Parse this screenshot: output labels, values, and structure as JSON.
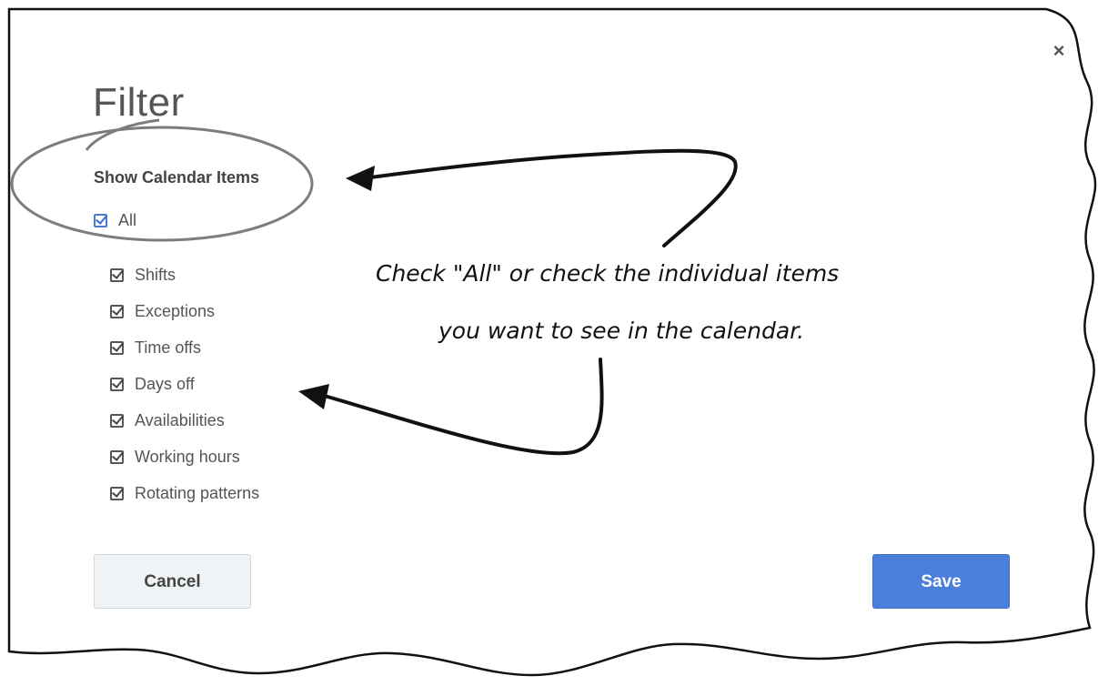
{
  "dialog": {
    "close_glyph": "×",
    "title": "Filter",
    "section_heading": "Show Calendar Items",
    "all_item": {
      "label": "All",
      "checked": true
    },
    "items": [
      {
        "label": "Shifts",
        "checked": true
      },
      {
        "label": "Exceptions",
        "checked": true
      },
      {
        "label": "Time offs",
        "checked": true
      },
      {
        "label": "Days off",
        "checked": true
      },
      {
        "label": "Availabilities",
        "checked": true
      },
      {
        "label": "Working hours",
        "checked": true
      },
      {
        "label": "Rotating patterns",
        "checked": true
      }
    ],
    "cancel_label": "Cancel",
    "save_label": "Save"
  },
  "annotation": {
    "line1": "Check \"All\" or check the individual items",
    "line2": "you want to see in the calendar."
  },
  "colors": {
    "accent": "#4a7fdb",
    "checkbox_all": "#4a7bd3",
    "text": "#555555"
  }
}
